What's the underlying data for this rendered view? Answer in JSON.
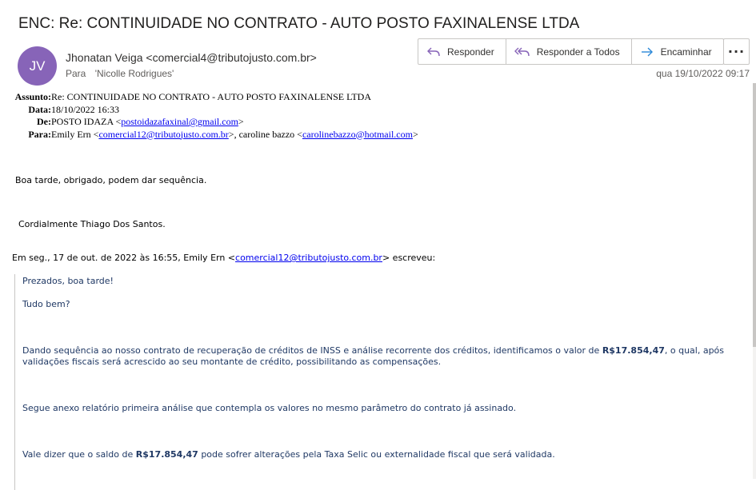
{
  "email": {
    "subject_title": "ENC: Re: CONTINUIDADE NO CONTRATO - AUTO POSTO FAXINALENSE LTDA",
    "avatar_initials": "JV",
    "avatar_color": "#8764b8",
    "sender": "Jhonatan Veiga <comercial4@tributojusto.com.br>",
    "to_label": "Para",
    "to_value": "'Nicolle Rodrigues'",
    "date": "qua 19/10/2022 09:17"
  },
  "toolbar": {
    "reply_label": "Responder",
    "reply_all_label": "Responder a Todos",
    "forward_label": "Encaminhar",
    "more_label": "···"
  },
  "fwd_header": {
    "assunto_label": "Assunto:",
    "assunto_value": "Re: CONTINUIDADE NO CONTRATO - AUTO POSTO FAXINALENSE LTDA",
    "data_label": "Data:",
    "data_value": "18/10/2022 16:33",
    "de_label": "De:",
    "de_name": "POSTO IDAZA <",
    "de_email": "postoidazafaxinal@gmail.com",
    "de_close": ">",
    "para_label": "Para:",
    "para_name1": "Emily Ern <",
    "para_email1": "comercial12@tributojusto.com.br",
    "para_sep": ">, caroline bazzo <",
    "para_email2": "carolinebazzo@hotmail.com",
    "para_close": ">"
  },
  "body": {
    "line1": "Boa tarde, obrigado, podem dar sequência.",
    "line2": "Cordialmente Thiago Dos Santos.",
    "quote_intro_pre": "Em seg., 17 de out. de 2022 às 16:55, Emily Ern <",
    "quote_intro_email": "comercial12@tributojusto.com.br",
    "quote_intro_post": "> escreveu:"
  },
  "quote": {
    "p1": "Prezados, boa tarde!",
    "p2": "Tudo bem?",
    "p3_pre": "Dando sequência ao nosso contrato de recuperação de créditos de INSS e análise recorrente dos créditos, identificamos o valor de ",
    "p3_amount": "R$17.854,47",
    "p3_post": ", o qual, após",
    "p3_line2": "validações fiscais será acrescido ao seu montante de crédito, possibilitando as compensações.",
    "p4": "Segue anexo relatório primeira análise que contempla os valores no mesmo parâmetro do contrato já assinado.",
    "p5_pre": "Vale dizer que o saldo de ",
    "p5_amount": "R$17.854,47",
    "p5_post": " pode sofrer alterações pela Taxa Selic ou externalidade fiscal que será validada."
  }
}
